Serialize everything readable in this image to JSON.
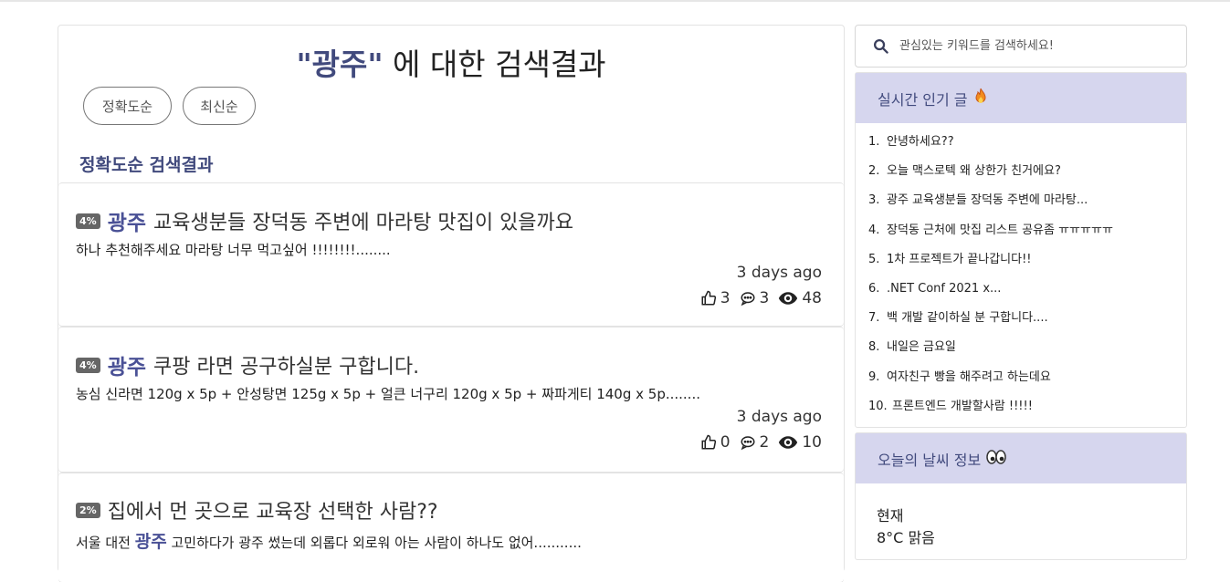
{
  "search_result": {
    "keyword": "\"광주\"",
    "title_suffix": " 에 대한 검색결과",
    "sort_buttons": [
      "정확도순",
      "최신순"
    ],
    "section_title": "정확도순 검색결과"
  },
  "posts": [
    {
      "percent": "4%",
      "title_keyword": "광주",
      "title": "교육생분들 장덕동 주변에 마라탕 맛집이 있을까요",
      "body_pre": "하나 추천해주세요 마라탕 너무 먹고싶어 !!!!!!!!........",
      "body_keyword": "",
      "body_post": "",
      "date": "3 days ago",
      "likes": "3",
      "comments": "3",
      "views": "48"
    },
    {
      "percent": "4%",
      "title_keyword": "광주",
      "title": "쿠팡 라면 공구하실분 구합니다.",
      "body_pre": "농심 신라면 120g x 5p + 안성탕면 125g x 5p + 얼큰 너구리 120g x 5p + 짜파게티 140g x 5p........",
      "body_keyword": "",
      "body_post": "",
      "date": "3 days ago",
      "likes": "0",
      "comments": "2",
      "views": "10"
    },
    {
      "percent": "2%",
      "title_keyword": "",
      "title": "집에서 먼 곳으로 교육장 선택한 사람??",
      "body_pre": "서울 대전 ",
      "body_keyword": "광주",
      "body_post": " 고민하다가 광주 썼는데 외롭다 외로워 아는 사람이 하나도 없어...........",
      "date": "",
      "likes": "",
      "comments": "",
      "views": ""
    }
  ],
  "sidebar": {
    "search_placeholder": "관심있는 키워드를 검색하세요!",
    "hot_title": "실시간 인기 글",
    "hot_items": [
      "안녕하세요??",
      "오늘 맥스로텍 왜 상한가 친거에요?",
      "광주 교육생분들 장덕동 주변에 마라탕...",
      "장덕동 근처에 맛집 리스트 공유좀 ㅠㅠㅠㅠㅠ",
      "1차 프로젝트가 끝나갑니다!!",
      ".NET Conf 2021 x...",
      "백 개발 같이하실 분 구합니다....",
      "내일은 금요일",
      "여자친구 빵을 해주려고 하는데요",
      "프론트엔드 개발할사람 !!!!!"
    ],
    "hot_numbers": [
      "1.",
      "2.",
      "3.",
      "4.",
      "5.",
      "6.",
      "7.",
      "8.",
      "9.",
      "10."
    ],
    "weather_title": "오늘의 날씨 정보",
    "weather_now_label": "현재",
    "weather_now_value": "8°C 맑음"
  },
  "colors": {
    "accent": "#414a7d",
    "keyword": "#4a5196",
    "panel_header_bg": "#d6d6ee",
    "badge_bg": "#666666"
  },
  "icons": [
    "search-icon",
    "fire-icon",
    "eyes-icon",
    "thumbs-up-icon",
    "comment-icon",
    "eye-icon"
  ]
}
